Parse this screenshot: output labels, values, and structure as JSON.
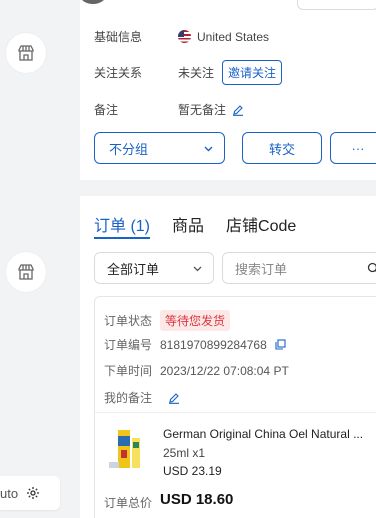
{
  "customer": {
    "basic_info_label": "基础信息",
    "country": "United States",
    "relationship_label": "关注关系",
    "relationship_value": "未关注",
    "invite_label": "邀请关注",
    "note_label": "备注",
    "note_value": "暂无备注"
  },
  "actions": {
    "group_select": "不分组",
    "transfer": "转交",
    "more": "···"
  },
  "tabs": [
    {
      "label": "订单 (1)",
      "active": true
    },
    {
      "label": "商品",
      "active": false
    },
    {
      "label": "店铺Code",
      "active": false
    }
  ],
  "filter": {
    "order_select": "全部订单",
    "search_placeholder": "搜索订单"
  },
  "order": {
    "status_label": "订单状态",
    "status_value": "等待您发货",
    "number_label": "订单编号",
    "number_value": "8181970899284768",
    "time_label": "下单时间",
    "time_value": "2023/12/22 07:08:04 PT",
    "my_note_label": "我的备注",
    "product": {
      "title": "German Original China Oel Natural ...",
      "spec": "25ml x1",
      "price": "USD 23.19"
    },
    "total_label": "订单总价",
    "total_value": "USD 18.60"
  },
  "sidebar": {
    "auto_label": "uto"
  },
  "colors": {
    "accent": "#1a62c7",
    "status_text": "#d9363e",
    "status_bg": "#fde8e8"
  }
}
